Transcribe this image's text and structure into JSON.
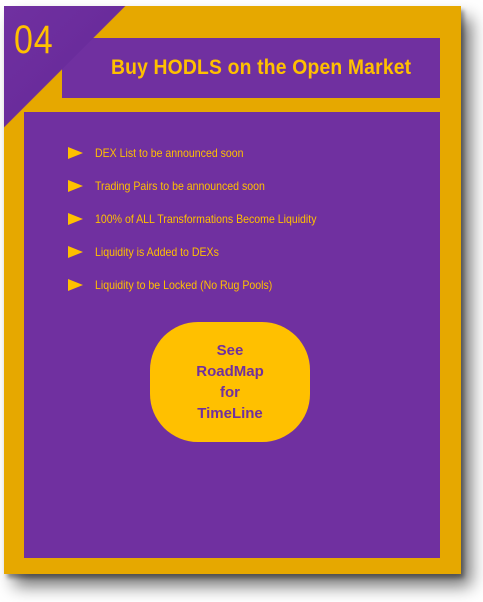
{
  "step": {
    "number": "04"
  },
  "header": {
    "title": "Buy HODLS on the Open Market"
  },
  "bullets": {
    "items": [
      "DEX List to be announced soon",
      "Trading Pairs to be announced soon",
      "100% of ALL Transformations Become Liquidity",
      "Liquidity is Added to DEXs",
      "Liquidity to be Locked (No Rug Pools)"
    ],
    "icon": "triangle-bullet-icon"
  },
  "cta": {
    "lines": [
      "See",
      "RoadMap",
      "for",
      "TimeLine"
    ]
  },
  "colors": {
    "gold": "#e6a800",
    "yellow": "#ffc000",
    "purple": "#7030a0"
  }
}
